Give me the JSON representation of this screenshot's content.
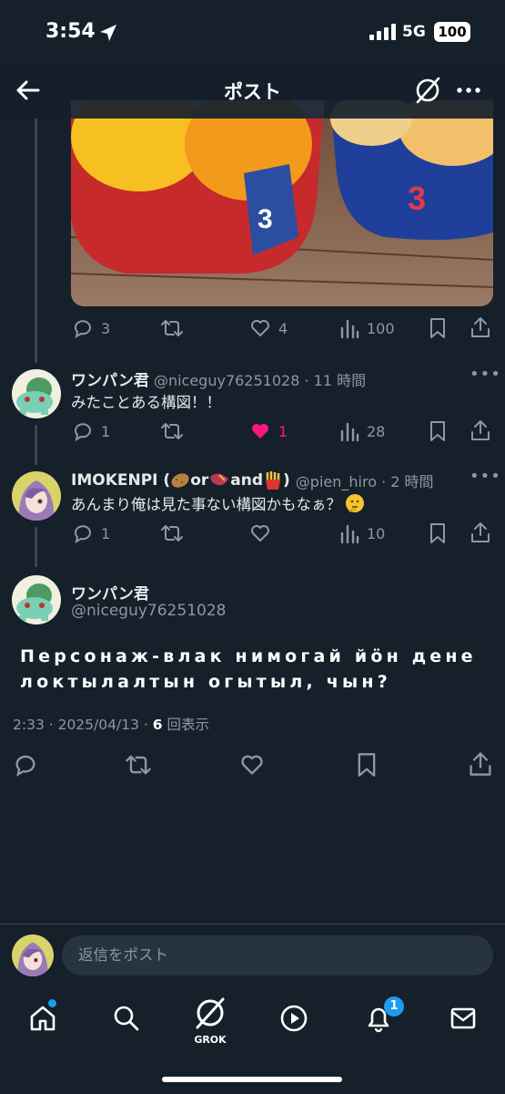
{
  "status": {
    "time": "3:54",
    "network": "5G",
    "battery": "100"
  },
  "header": {
    "title": "ポスト"
  },
  "colors": {
    "bg": "#15202b",
    "accent": "#1d9bf0",
    "like_active": "#f91880",
    "muted": "#8b98a5"
  },
  "main_post_stats": {
    "replies": "3",
    "likes": "4",
    "views": "100"
  },
  "replies": [
    {
      "name": "ワンパン君",
      "handle": "@niceguy76251028 · 11 時間",
      "text": "みたことある構図！！",
      "replies": "1",
      "likes": "1",
      "liked": true,
      "views": "28"
    },
    {
      "name_prefix": "IMOKENPI (",
      "name_or": "or",
      "name_and": "and",
      "name_suffix": ")",
      "handle": "@pien_hiro · 2 時間",
      "text": "あんまり俺は見た事ない構図かもなぁ？",
      "replies": "1",
      "views": "10"
    }
  ],
  "focused": {
    "name": "ワンパン君",
    "handle": "@niceguy76251028",
    "text": "Персонаж-влак нимогай йӧн дене локтылалтын огытыл, чын?",
    "time": "2:33 · 2025/04/13 · ",
    "views_count": "6",
    "views_label": " 回表示"
  },
  "reply_input": {
    "placeholder": "返信をポスト"
  },
  "tabbar": {
    "grok_label": "GROK",
    "notification_count": "1"
  }
}
